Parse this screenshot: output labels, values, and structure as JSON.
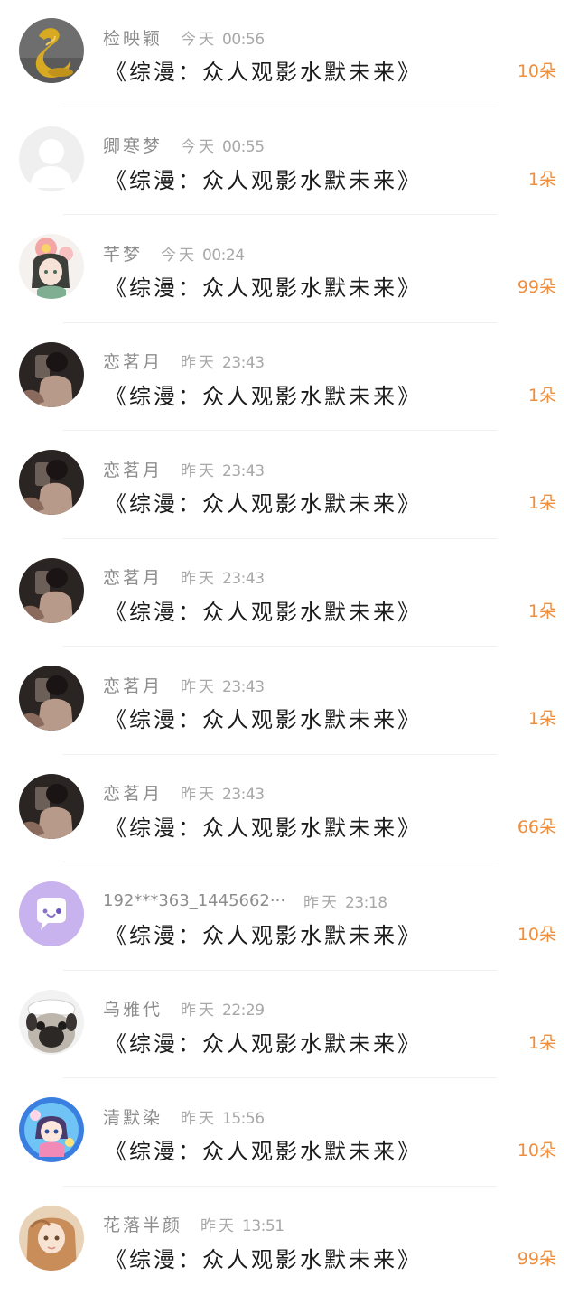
{
  "gifts": [
    {
      "user": "检映颖",
      "day": "今天",
      "time": "00:56",
      "book": "《综漫：众人观影水默未来》",
      "count": "10朵",
      "avatar_icon": "golden-snake-statue-avatar-icon"
    },
    {
      "user": "卿寒梦",
      "day": "今天",
      "time": "00:55",
      "book": "《综漫：众人观影水默未来》",
      "count": "1朵",
      "avatar_icon": "default-person-avatar-icon"
    },
    {
      "user": "芊梦",
      "day": "今天",
      "time": "00:24",
      "book": "《综漫：众人观影水默未来》",
      "count": "99朵",
      "avatar_icon": "anime-girl-flower-avatar-icon"
    },
    {
      "user": "恋茗月",
      "day": "昨天",
      "time": "23:43",
      "book": "《综漫：众人观影水默未来》",
      "count": "1朵",
      "avatar_icon": "dark-photo-avatar-icon"
    },
    {
      "user": "恋茗月",
      "day": "昨天",
      "time": "23:43",
      "book": "《综漫：众人观影水默未来》",
      "count": "1朵",
      "avatar_icon": "dark-photo-avatar-icon"
    },
    {
      "user": "恋茗月",
      "day": "昨天",
      "time": "23:43",
      "book": "《综漫：众人观影水默未来》",
      "count": "1朵",
      "avatar_icon": "dark-photo-avatar-icon"
    },
    {
      "user": "恋茗月",
      "day": "昨天",
      "time": "23:43",
      "book": "《综漫：众人观影水默未来》",
      "count": "1朵",
      "avatar_icon": "dark-photo-avatar-icon"
    },
    {
      "user": "恋茗月",
      "day": "昨天",
      "time": "23:43",
      "book": "《综漫：众人观影水默未来》",
      "count": "66朵",
      "avatar_icon": "dark-photo-avatar-icon"
    },
    {
      "user": "192***363_1445662···",
      "day": "昨天",
      "time": "23:18",
      "book": "《综漫：众人观影水默未来》",
      "count": "10朵",
      "avatar_icon": "chat-bubble-avatar-icon"
    },
    {
      "user": "乌雅代",
      "day": "昨天",
      "time": "22:29",
      "book": "《综漫：众人观影水默未来》",
      "count": "1朵",
      "avatar_icon": "pug-dog-avatar-icon"
    },
    {
      "user": "清默染",
      "day": "昨天",
      "time": "15:56",
      "book": "《综漫：众人观影水默未来》",
      "count": "10朵",
      "avatar_icon": "anime-chibi-avatar-icon"
    },
    {
      "user": "花落半颜",
      "day": "昨天",
      "time": "13:51",
      "book": "《综漫：众人观影水默未来》",
      "count": "99朵",
      "avatar_icon": "anime-girl-avatar-icon"
    }
  ],
  "colors": {
    "count": "#ef8e3c",
    "username": "#8d8d8d",
    "time": "#a8a8a8",
    "book": "#1b1b1b",
    "divider": "#f0f0f0"
  }
}
